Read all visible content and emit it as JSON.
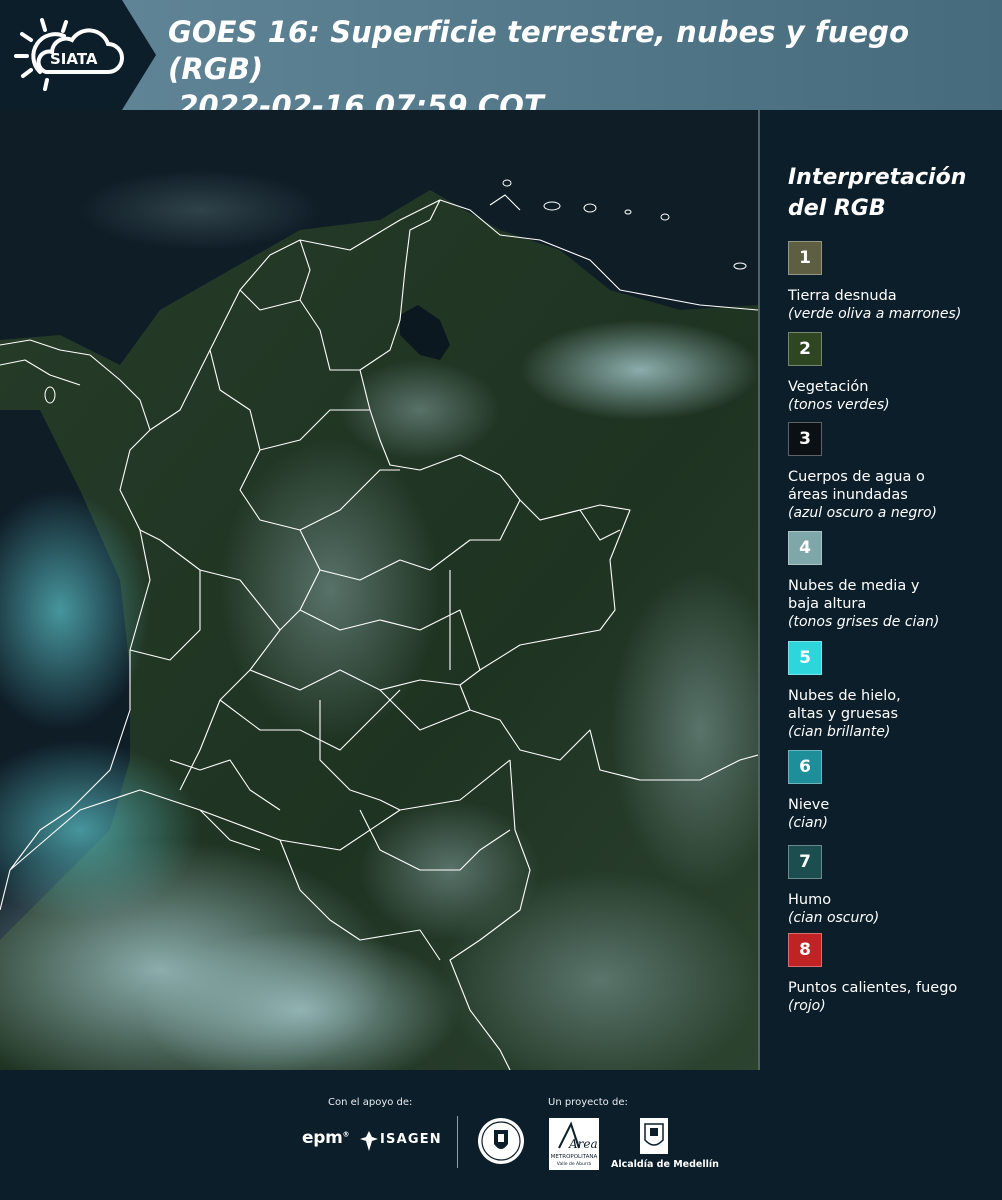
{
  "header": {
    "logo_text": "SIATA",
    "title_line1": "GOES 16: Superficie terrestre, nubes y fuego (RGB)",
    "title_line2": " 2022-02-16 07:59 COT"
  },
  "legend": {
    "title_line1": "Interpretación",
    "title_line2": "del RGB",
    "items": [
      {
        "num": "1",
        "color": "#5e5e43",
        "label": "Tierra desnuda",
        "sub": "(verde oliva a marrones)"
      },
      {
        "num": "2",
        "color": "#2f4622",
        "label": "Vegetación",
        "sub": "(tonos verdes)"
      },
      {
        "num": "3",
        "color": "#0b1014",
        "label": "Cuerpos de agua o",
        "label2": "áreas inundadas",
        "sub": "(azul oscuro a negro)"
      },
      {
        "num": "4",
        "color": "#7fa6a8",
        "label": "Nubes de media y",
        "label2": "baja altura",
        "sub": "(tonos grises de cian)"
      },
      {
        "num": "5",
        "color": "#2ed6dc",
        "label": "Nubes de hielo,",
        "label2": "altas y gruesas",
        "sub": "(cian brillante)"
      },
      {
        "num": "6",
        "color": "#1d8e9a",
        "label": "Nieve",
        "sub": "(cian)"
      },
      {
        "num": "7",
        "color": "#1c4e50",
        "label": "Humo",
        "sub": "(cian oscuro)"
      },
      {
        "num": "8",
        "color": "#c02323",
        "label": "Puntos calientes, fuego",
        "sub": "(rojo)"
      }
    ]
  },
  "footer": {
    "support_label": "Con el apoyo de:",
    "project_label": "Un proyecto de:",
    "epm": "epm",
    "isagen": "ISAGEN",
    "area_text": "Área",
    "area_sub": "METROPOLITANA",
    "area_sub2": "Valle de Aburrá",
    "alcaldia": "Alcaldía de Medellín"
  },
  "colors": {
    "background": "#0c1e2a",
    "header_band": "#567b8d",
    "ocean": "#0f1f2a",
    "land": "#223524",
    "cloud": "#8fb1b3",
    "border_line": "#ffffff"
  }
}
